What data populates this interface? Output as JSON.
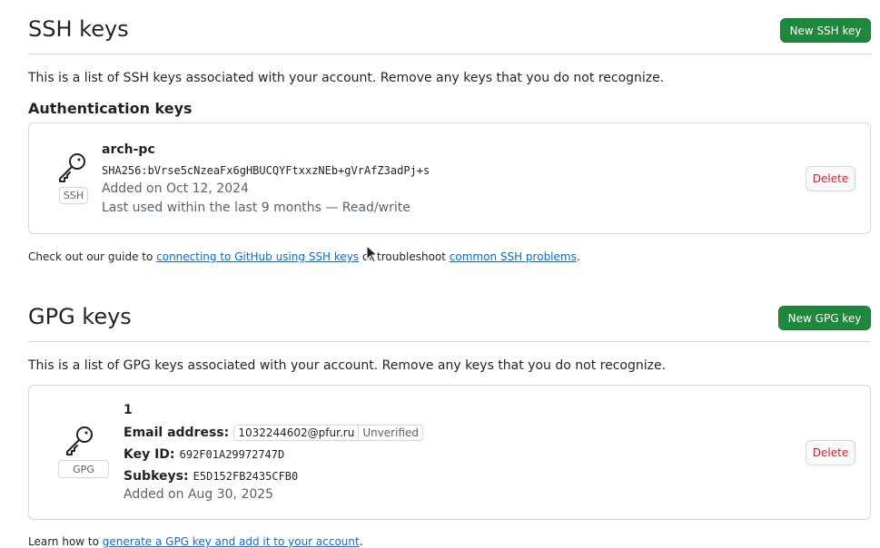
{
  "ssh": {
    "title": "SSH keys",
    "new_button": "New SSH key",
    "description": "This is a list of SSH keys associated with your account. Remove any keys that you do not recognize.",
    "subheading": "Authentication keys",
    "key": {
      "name": "arch-pc",
      "fingerprint": "SHA256:bVrse5cNzeaFx6gHBUCQYFtxxzNEb+gVrAfZ3adPj+s",
      "added": "Added on Oct 12, 2024",
      "last_used": "Last used within the last 9 months — Read/write",
      "badge": "SSH",
      "delete_label": "Delete",
      "icon": "key-icon"
    },
    "footer": {
      "prefix": "Check out our guide to ",
      "link1": "connecting to GitHub using SSH keys",
      "middle": " or troubleshoot ",
      "link2": "common SSH problems",
      "suffix": "."
    }
  },
  "gpg": {
    "title": "GPG keys",
    "new_button": "New GPG key",
    "description": "This is a list of GPG keys associated with your account. Remove any keys that you do not recognize.",
    "key": {
      "name": "1",
      "email_label": "Email address:",
      "email": "1032244602@pfur.ru",
      "email_status": "Unverified",
      "key_id_label": "Key ID:",
      "key_id": "692F01A29972747D",
      "subkeys_label": "Subkeys:",
      "subkeys": "E5D152FB2435CFB0",
      "added": "Added on Aug 30, 2025",
      "badge": "GPG",
      "delete_label": "Delete",
      "icon": "key-icon"
    },
    "footer": {
      "prefix": "Learn how to ",
      "link": "generate a GPG key and add it to your account",
      "suffix": "."
    }
  },
  "colors": {
    "primary_button": "#1f883d",
    "danger": "#d1242f",
    "link": "#0969da",
    "border": "#d1d9e0"
  }
}
